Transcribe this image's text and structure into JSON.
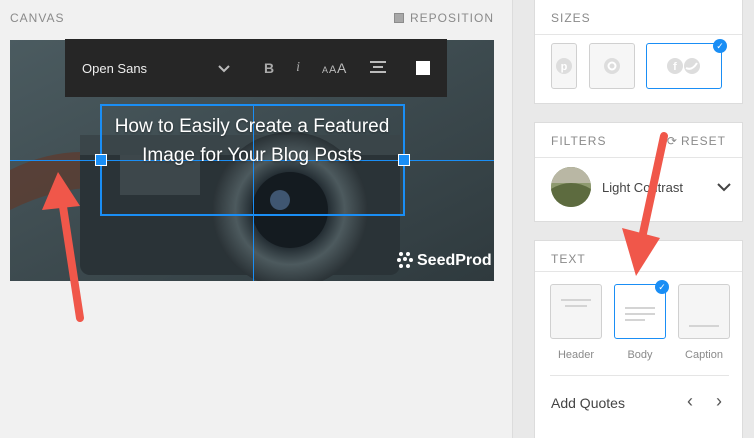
{
  "canvas": {
    "label": "CANVAS",
    "reposition_label": "REPOSITION",
    "headline": "How to Easily Create a Featured Image for Your Blog Posts",
    "brand": "SeedProd"
  },
  "toolbar": {
    "font_name": "Open Sans",
    "bold_label": "B",
    "italic_label": "i",
    "size_label": "AAA",
    "align_icon": "align-center-icon",
    "color_swatch": "#ffffff"
  },
  "sizes": {
    "label": "SIZES",
    "options": [
      "pinterest-icon",
      "instagram-icon",
      "facebook-twitter-icon"
    ],
    "selected": "facebook-twitter-icon"
  },
  "filters": {
    "label": "FILTERS",
    "reset_label": "RESET",
    "selected_filter": "Light Contrast"
  },
  "text": {
    "label": "TEXT",
    "styles": [
      "Header",
      "Body",
      "Caption"
    ],
    "selected": "Body",
    "add_quotes_label": "Add Quotes",
    "prev_label": "‹",
    "next_label": "›"
  },
  "colors": {
    "accent": "#1a8ef5",
    "arrow": "#f0574a",
    "toolbar_bg": "#262626"
  }
}
